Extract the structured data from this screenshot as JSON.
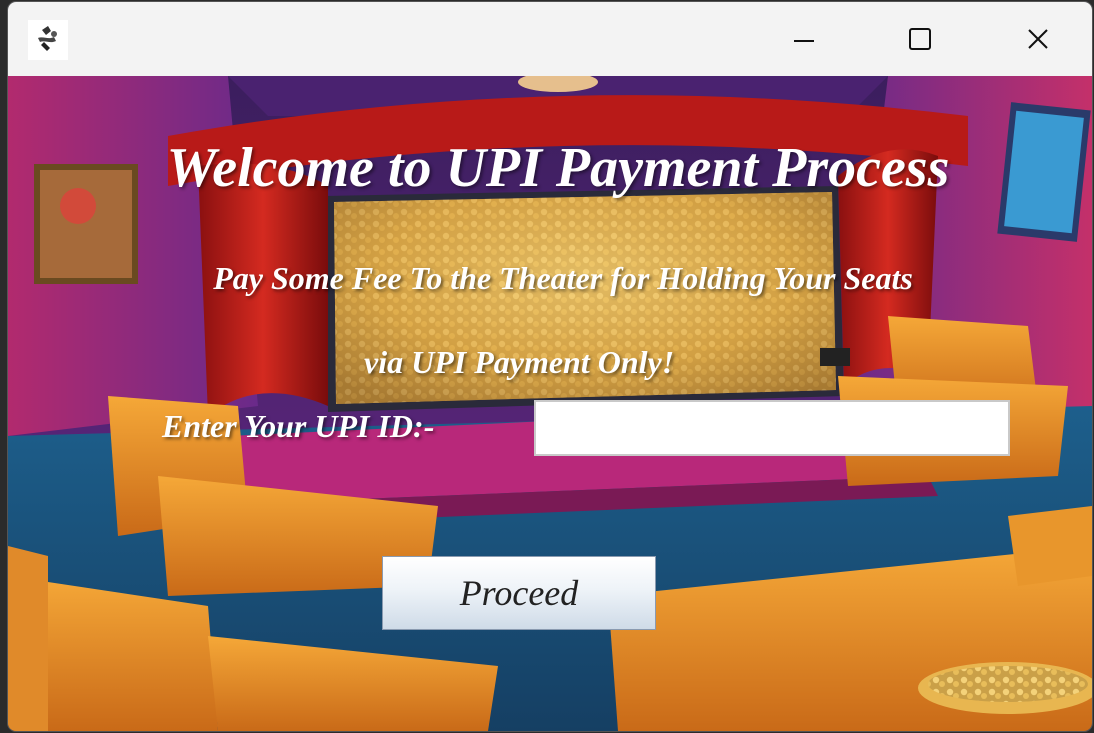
{
  "window": {
    "app_icon": "java-duke-icon",
    "controls": [
      "minimize-icon",
      "maximize-icon",
      "close-icon"
    ]
  },
  "content": {
    "title": "Welcome to UPI Payment Process",
    "line1": "Pay Some Fee To the Theater for Holding Your Seats",
    "line2": "via UPI Payment Only!",
    "upi_label": "Enter Your UPI ID:-",
    "upi_value": "",
    "proceed_label": "Proceed"
  },
  "colors": {
    "text": "#ffffff",
    "background_theme": "#7a2f8f",
    "seat": "#e8932a",
    "floor": "#1e6a9a"
  }
}
